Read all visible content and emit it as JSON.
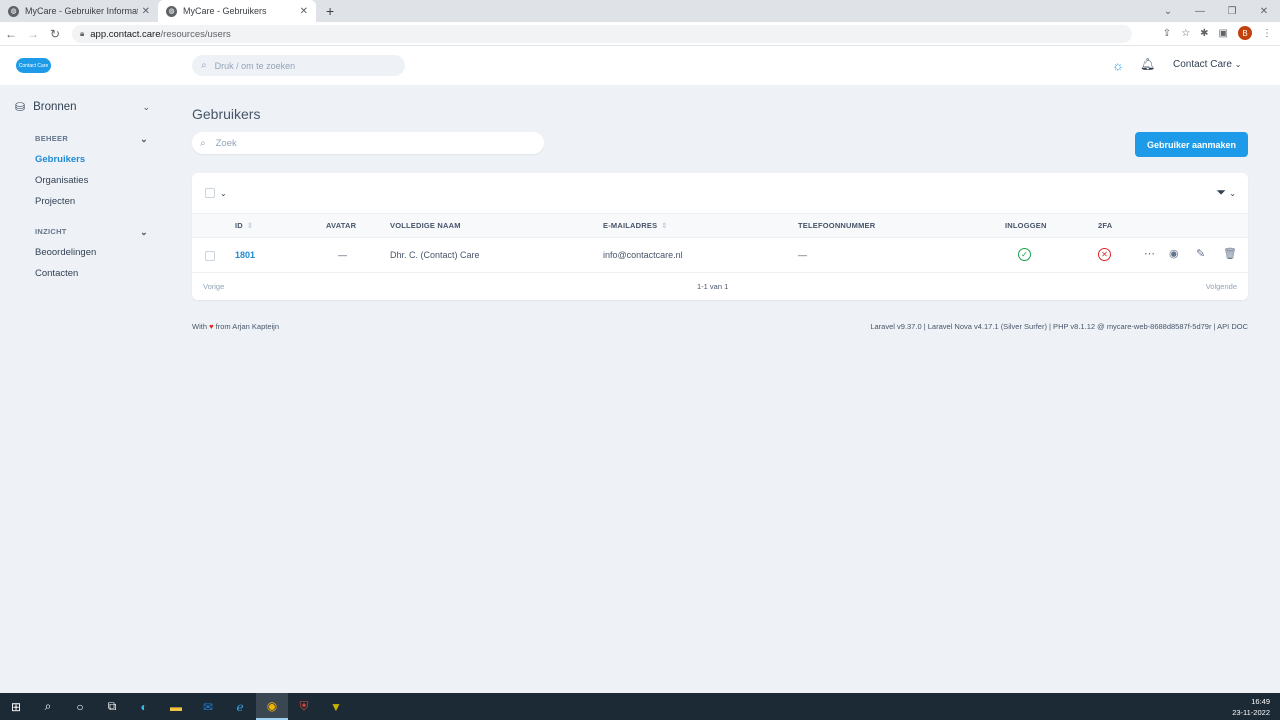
{
  "browser": {
    "tabs": [
      {
        "label": "MyCare - Gebruiker Informatie: C",
        "close": "✕"
      },
      {
        "label": "MyCare - Gebruikers",
        "close": "✕"
      }
    ],
    "new_tab": "+",
    "window_controls": [
      "⌄",
      "—",
      "❐",
      "✕"
    ],
    "url_host": "app.contact.care",
    "url_path": "/resources/users",
    "profile_initial": "B"
  },
  "header": {
    "logo_text": "Contact Care",
    "search_placeholder": "Druk / om te zoeken",
    "user_menu": "Contact Care"
  },
  "sidebar": {
    "section": "Bronnen",
    "groups": [
      {
        "label": "BEHEER",
        "items": [
          "Gebruikers",
          "Organisaties",
          "Projecten"
        ]
      },
      {
        "label": "INZICHT",
        "items": [
          "Beoordelingen",
          "Contacten"
        ]
      }
    ],
    "active_item": "Gebruikers"
  },
  "main": {
    "title": "Gebruikers",
    "search_placeholder": "Zoek",
    "create_button": "Gebruiker aanmaken",
    "columns": [
      "ID",
      "AVATAR",
      "VOLLEDIGE NAAM",
      "E-MAILADRES",
      "TELEFOONNUMMER",
      "INLOGGEN",
      "2FA"
    ],
    "rows": [
      {
        "id": "1801",
        "avatar": "—",
        "name": "Dhr. C. (Contact) Care",
        "email": "info@contactcare.nl",
        "phone": "—",
        "login": true,
        "twofa": false
      }
    ],
    "pager": {
      "prev": "Vorige",
      "info": "1-1 van 1",
      "next": "Volgende"
    }
  },
  "footer": {
    "left_pre": "With",
    "left_post": "from Arjan Kapteijn",
    "right": "Laravel v9.37.0 | Laravel Nova v4.17.1 (Silver Surfer) | PHP v8.1.12 @ mycare-web-8688d8587f-5d79r | API DOC"
  },
  "taskbar": {
    "time": "16:49",
    "date": "23-11-2022"
  },
  "colors": {
    "accent": "#1e9be8",
    "success": "#16a34a",
    "danger": "#dc2626"
  }
}
